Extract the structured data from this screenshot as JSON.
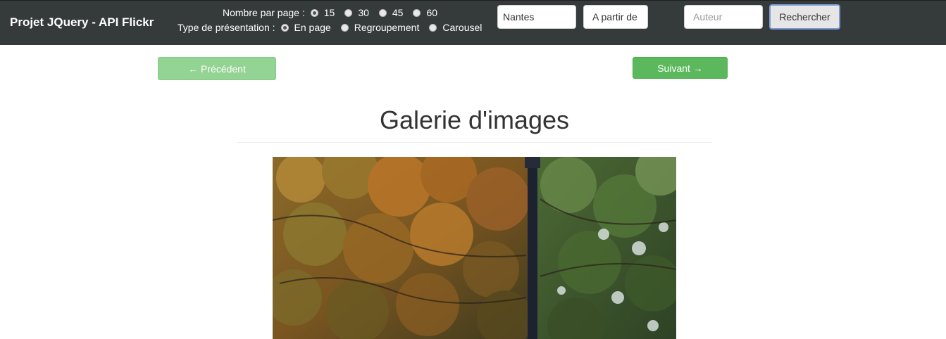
{
  "navbar": {
    "brand": "Projet JQuery - API Flickr",
    "per_page": {
      "label": "Nombre par page :",
      "options": [
        "15",
        "30",
        "45",
        "60"
      ],
      "selected": "15"
    },
    "presentation": {
      "label": "Type de présentation :",
      "options": [
        "En page",
        "Regroupement",
        "Carousel"
      ],
      "selected": "En page"
    },
    "city_input": {
      "value": "Nantes"
    },
    "date_input": {
      "value": "A partir de"
    },
    "author_input": {
      "placeholder": "Auteur"
    },
    "search_button": "Rechercher"
  },
  "pager": {
    "prev_label": "← Précédent",
    "next_label": "Suivant →"
  },
  "gallery": {
    "title": "Galerie d'images"
  },
  "colors": {
    "navbar_bg": "#353a3b",
    "success_green": "#5cb85c",
    "success_green_disabled": "#93d393"
  }
}
